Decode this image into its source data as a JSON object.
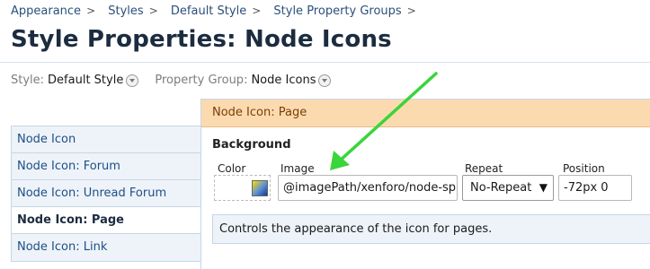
{
  "breadcrumb": {
    "items": [
      "Appearance",
      "Styles",
      "Default Style",
      "Style Property Groups"
    ],
    "separator": ">"
  },
  "page_title": "Style Properties: Node Icons",
  "filters": {
    "style_label": "Style:",
    "style_value": "Default Style",
    "group_label": "Property Group:",
    "group_value": "Node Icons"
  },
  "sidebar": {
    "items": [
      {
        "label": "Node Icon"
      },
      {
        "label": "Node Icon: Forum"
      },
      {
        "label": "Node Icon: Unread Forum"
      },
      {
        "label": "Node Icon: Page"
      },
      {
        "label": "Node Icon: Link"
      }
    ],
    "active_index": 3
  },
  "panel": {
    "header": "Node Icon: Page",
    "section": "Background",
    "fields": {
      "color_label": "Color",
      "image_label": "Image",
      "image_value": "@imagePath/xenforo/node-sp",
      "repeat_label": "Repeat",
      "repeat_value": "No-Repeat",
      "position_label": "Position",
      "position_value": "-72px 0"
    },
    "help_text": "Controls the appearance of the icon for pages."
  },
  "colors": {
    "link": "#2b4f7a",
    "panel_header_bg": "#fcdaaf",
    "panel_header_text": "#7a3f06",
    "sidebar_bg": "#eef3f9",
    "border": "#c7d6e6",
    "annotation_arrow": "#39d53a"
  },
  "icons": {
    "menu": "chevron-down-circle-icon",
    "color_swatch": "color-picker-swatch-icon",
    "select_caret": "caret-down-icon",
    "annotation": "arrow-annotation-icon"
  }
}
